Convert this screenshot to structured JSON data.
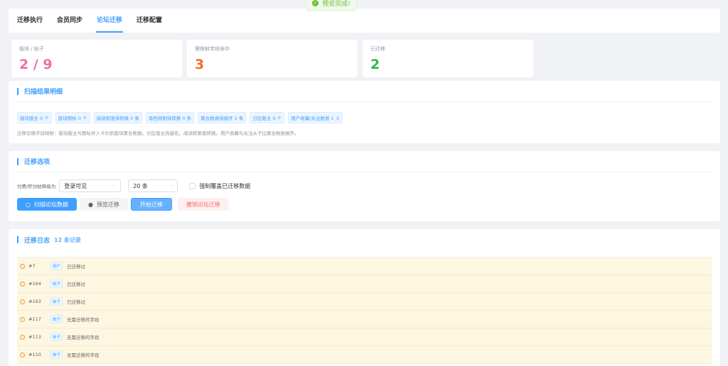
{
  "toast": {
    "text": "预览完成!"
  },
  "tabs": [
    {
      "label": "迁移执行"
    },
    {
      "label": "会员同步"
    },
    {
      "label": "论坛迁移"
    },
    {
      "label": "迁移配置"
    }
  ],
  "stats": [
    {
      "label": "版块 / 帖子",
      "value": "2 / 9",
      "color": "#f06eaa"
    },
    {
      "label": "需映射字段命中",
      "value": "3",
      "color": "#f36c21"
    },
    {
      "label": "已迁移",
      "value": "2",
      "color": "#36b548"
    }
  ],
  "scan": {
    "title": "扫描结果明细",
    "tags": [
      "版块版主 0 个",
      "版块图标 0 个",
      "阅读权限待转换 0 条",
      "角色限制待转换 0 条",
      "聚合数据待展开 2 条",
      "分区版主 0 个",
      "用户收藏/关注数据 1 人"
    ],
    "note": "迁移仅做字段映射：版块版主与图标并入卡尔奶版块聚合数据。分区版主改键名。阅读权限值转换。用户收藏与关注从子比聚合数据展开。"
  },
  "options": {
    "title": "迁移选项",
    "paid_label": "付费/积分帖降级为",
    "visibility": "登录可见",
    "count": "20 条",
    "force_overwrite_label": "强制覆盖已迁移数据",
    "buttons": {
      "scan": "扫描论坛数据",
      "preview": "预览迁移",
      "start": "开始迁移",
      "revoke": "撤销论坛迁移"
    }
  },
  "log": {
    "title": "迁移日志",
    "count": "12 条记录",
    "rows": [
      {
        "id": "#7",
        "type": "用户",
        "msg": "已迁移过"
      },
      {
        "id": "#164",
        "type": "帖子",
        "msg": "已迁移过"
      },
      {
        "id": "#163",
        "type": "帖子",
        "msg": "已迁移过"
      },
      {
        "id": "#117",
        "type": "帖子",
        "msg": "无需迁移的字段"
      },
      {
        "id": "#113",
        "type": "帖子",
        "msg": "无需迁移的字段"
      },
      {
        "id": "#110",
        "type": "帖子",
        "msg": "无需迁移的字段"
      }
    ]
  }
}
